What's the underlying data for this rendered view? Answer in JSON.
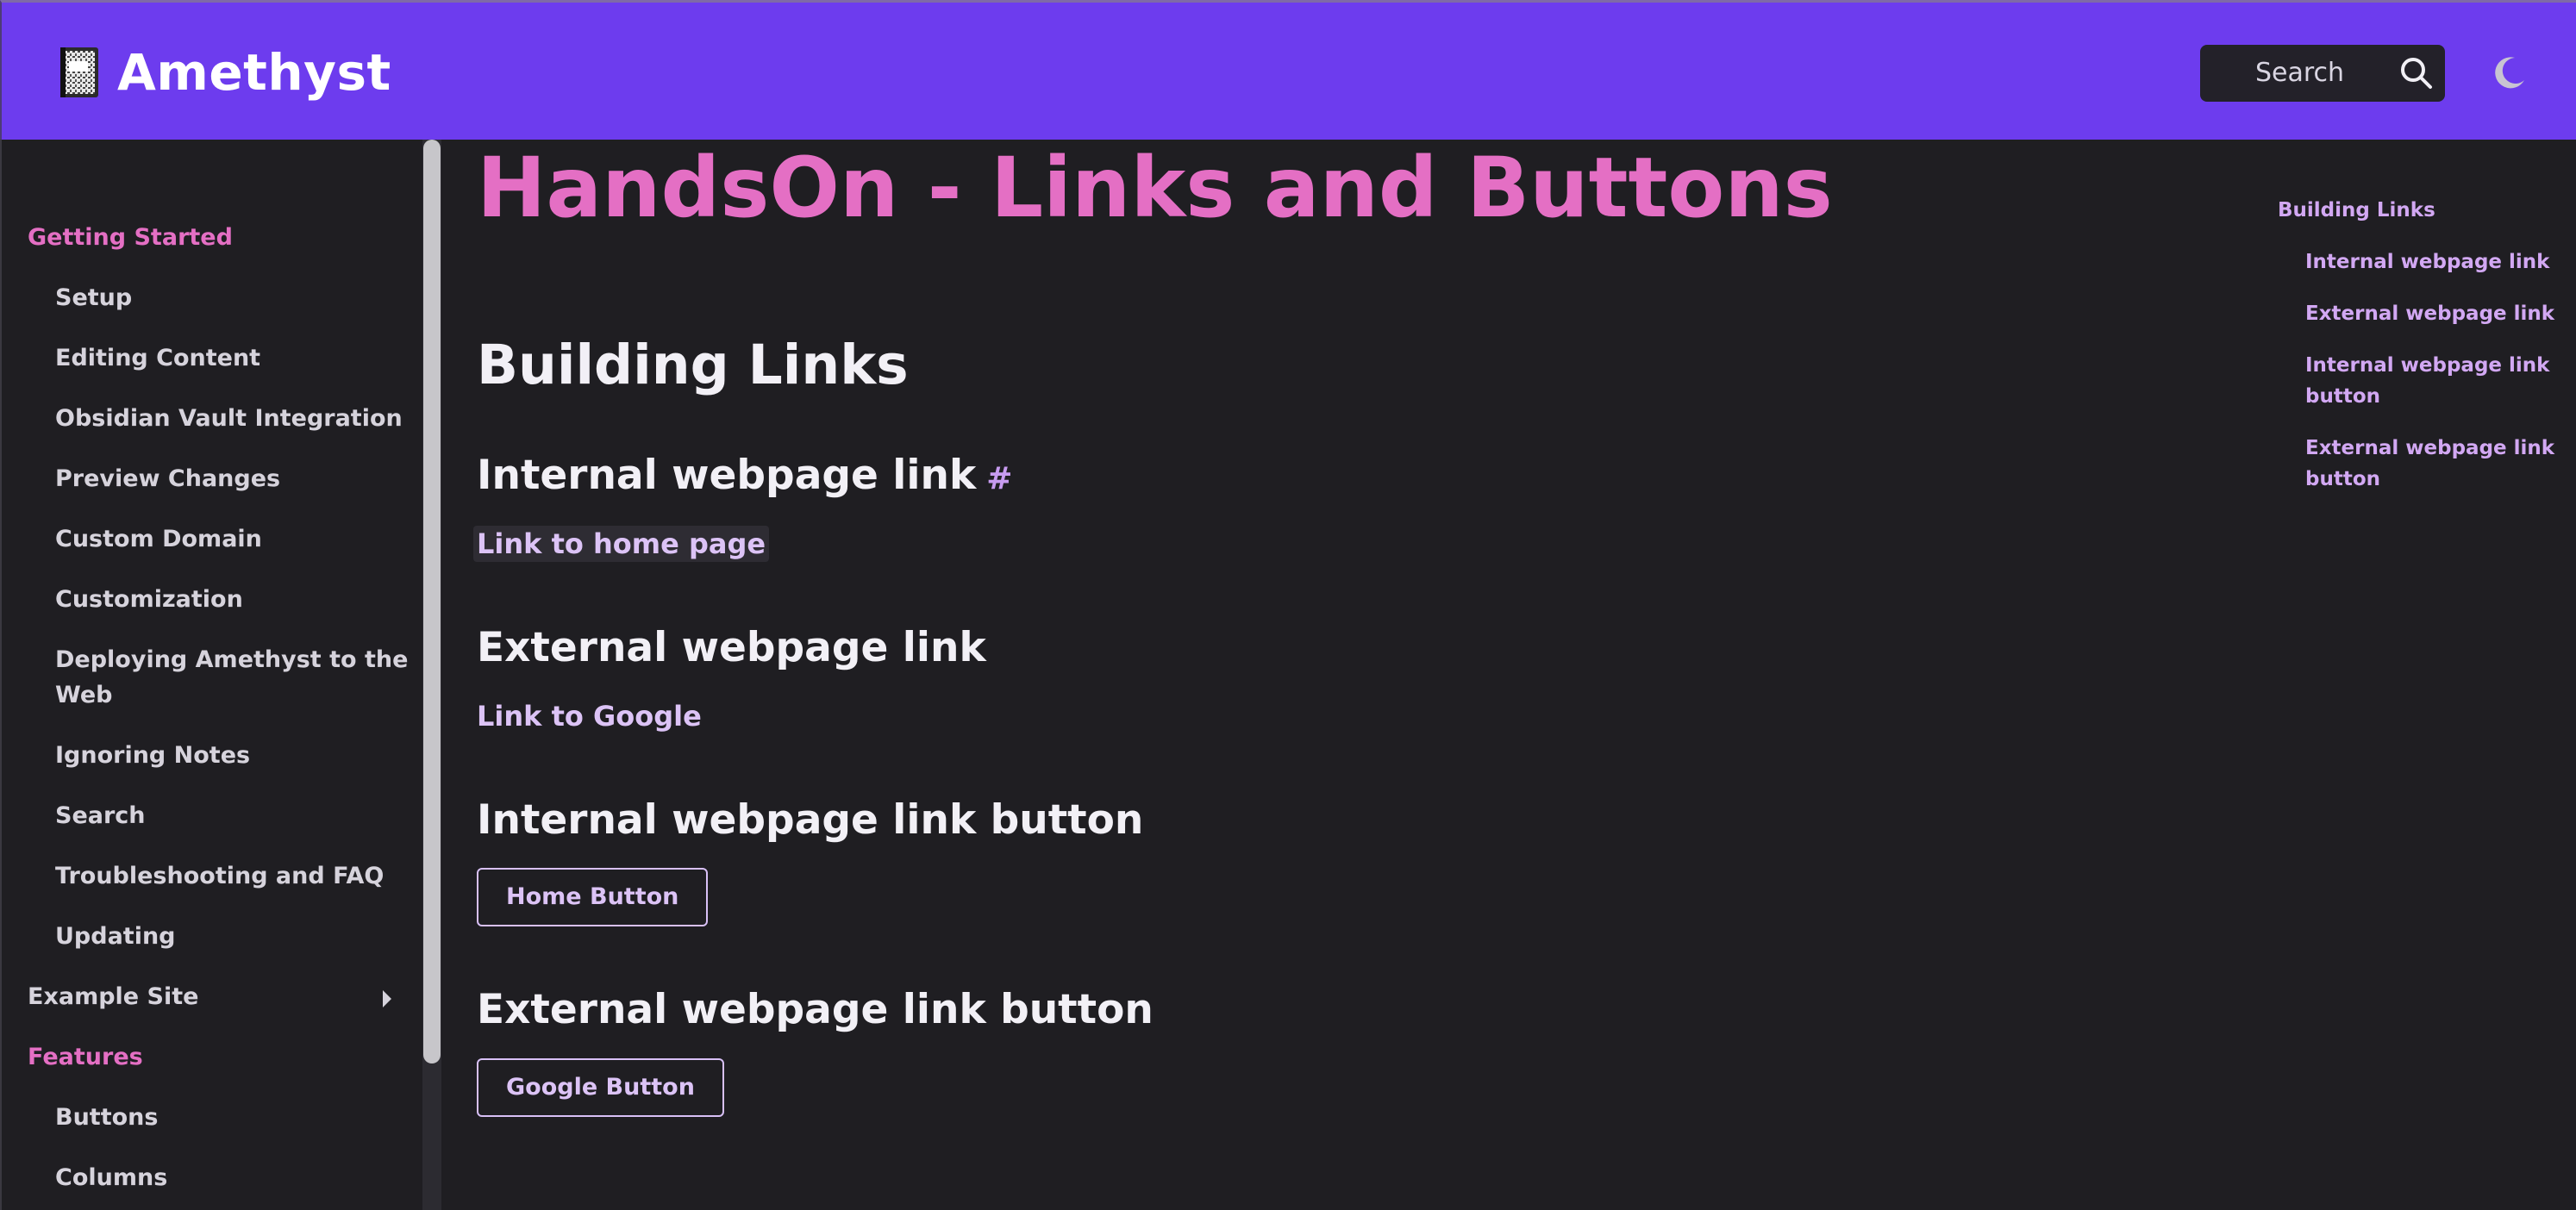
{
  "header": {
    "brand_title": "Amethyst",
    "search_label": "Search",
    "brand_color": "#6d3cee"
  },
  "sidebar": {
    "items": [
      {
        "label": "Getting Started",
        "kind": "section"
      },
      {
        "label": "Setup",
        "kind": "child"
      },
      {
        "label": "Editing Content",
        "kind": "child"
      },
      {
        "label": "Obsidian Vault Integration",
        "kind": "child"
      },
      {
        "label": "Preview Changes",
        "kind": "child"
      },
      {
        "label": "Custom Domain",
        "kind": "child"
      },
      {
        "label": "Customization",
        "kind": "child"
      },
      {
        "label": "Deploying Amethyst to the",
        "kind": "child"
      },
      {
        "label": "Web",
        "kind": "child-continuation"
      },
      {
        "label": "Ignoring Notes",
        "kind": "child"
      },
      {
        "label": "Search",
        "kind": "child"
      },
      {
        "label": "Troubleshooting and FAQ",
        "kind": "child"
      },
      {
        "label": "Updating",
        "kind": "child"
      },
      {
        "label": "Example Site",
        "kind": "collapsed"
      },
      {
        "label": "Features",
        "kind": "section"
      },
      {
        "label": "Buttons",
        "kind": "child"
      },
      {
        "label": "Columns",
        "kind": "child"
      }
    ]
  },
  "main": {
    "title": "HandsOn - Links and Buttons",
    "section_heading": "Building Links",
    "anchor_symbol": "#",
    "subsections": [
      {
        "heading": "Internal webpage link",
        "content": "Link to home page"
      },
      {
        "heading": "External webpage link",
        "content": "Link to Google"
      },
      {
        "heading": "Internal webpage link button",
        "content": "Home Button"
      },
      {
        "heading": "External webpage link button",
        "content": "Google Button"
      }
    ]
  },
  "toc": {
    "items": [
      "Building Links",
      "Internal webpage link",
      "External webpage link",
      "Internal webpage link",
      "button",
      "External webpage link",
      "button"
    ]
  },
  "icons": {
    "brand": "notebook-icon",
    "search": "search-icon",
    "theme": "moon-icon",
    "expand": "chevron-right-icon"
  },
  "colors": {
    "background": "#1f1e22",
    "accent_pink": "#e46fc4",
    "link_lavender": "#dcc3f6"
  }
}
